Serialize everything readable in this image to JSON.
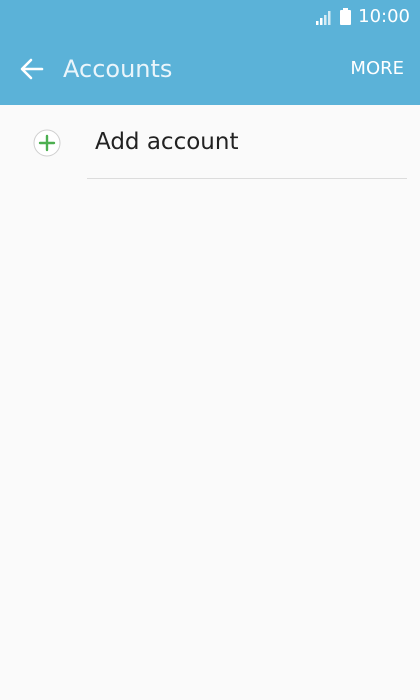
{
  "status_bar": {
    "time": "10:00",
    "icons": [
      "signal-icon",
      "battery-icon"
    ]
  },
  "app_bar": {
    "title": "Accounts",
    "back_icon": "arrow-left-icon",
    "more_label": "MORE"
  },
  "list": {
    "items": [
      {
        "label": "Add account",
        "icon": "plus-circle-icon"
      }
    ]
  },
  "colors": {
    "header": "#5bb2d8",
    "background": "#fafafa",
    "accent_green": "#4caf50"
  }
}
